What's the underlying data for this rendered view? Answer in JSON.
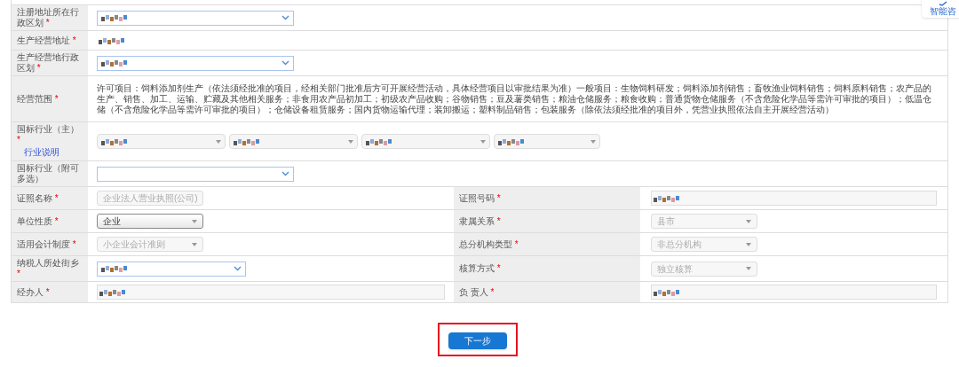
{
  "rows": [
    {
      "cells": [
        {
          "label": "注册地址所在行政区划",
          "required_mark": "*",
          "field": {
            "kind": "dropdown",
            "redacted": true
          }
        }
      ]
    },
    {
      "cells": [
        {
          "label": "生产经营地址",
          "required_mark": "*",
          "field": {
            "kind": "plain",
            "redacted": true
          }
        }
      ]
    },
    {
      "cells": [
        {
          "label": "生产经营地行政区划",
          "required_mark": "*",
          "field": {
            "kind": "dropdown",
            "redacted": true
          }
        }
      ]
    },
    {
      "cells": [
        {
          "label": "经营范围",
          "required_mark": "*",
          "field": {
            "kind": "paragraph",
            "text": "许可项目：饲料添加剂生产（依法须经批准的项目，经相关部门批准后方可开展经营活动，具体经营项目以审批结果为准）一般项目：生物饲料研发；饲料添加剂销售；畜牧渔业饲料销售；饲料原料销售；农产品的生产、销售、加工、运输、贮藏及其他相关服务；非食用农产品初加工；初级农产品收购；谷物销售；豆及薯类销售；粮油仓储服务；粮食收购；普通货物仓储服务（不含危险化学品等需许可审批的项目）；低温仓储（不含危险化学品等需许可审批的项目）；仓储设备租赁服务；国内货物运输代理；装卸搬运；塑料制品销售；包装服务（除依法须经批准的项目外，凭营业执照依法自主开展经营活动）"
          }
        }
      ]
    },
    {
      "cells": [
        {
          "label": "国标行业（主）",
          "required_mark": "*",
          "link": "行业说明",
          "field": {
            "kind": "multi",
            "selects": [
              {
                "redacted": true
              },
              {
                "redacted": true
              },
              {
                "redacted": true
              },
              {
                "redacted": true
              }
            ]
          }
        }
      ]
    },
    {
      "cells": [
        {
          "label": "国标行业（附可多选）",
          "field": {
            "kind": "dropdown",
            "redacted": false
          }
        }
      ]
    },
    {
      "cells": [
        {
          "label": "证照名称",
          "required_mark": "*",
          "field": {
            "kind": "select",
            "value": "企业法人营业执照(公司)",
            "disabled": true
          }
        },
        {
          "label": "证照号码",
          "required_mark": "*",
          "field": {
            "kind": "input",
            "redacted": true
          }
        }
      ]
    },
    {
      "cells": [
        {
          "label": "单位性质",
          "required_mark": "*",
          "field": {
            "kind": "select",
            "value": "企业",
            "disabled": false
          }
        },
        {
          "label": "隶属关系",
          "required_mark": "*",
          "field": {
            "kind": "select",
            "value": "县市",
            "disabled": true
          }
        }
      ]
    },
    {
      "cells": [
        {
          "label": "适用会计制度",
          "required_mark": "*",
          "field": {
            "kind": "select",
            "value": "小企业会计准则",
            "disabled": true
          }
        },
        {
          "label": "总分机构类型",
          "required_mark": "*",
          "field": {
            "kind": "select",
            "value": "非总分机构",
            "disabled": true
          }
        }
      ]
    },
    {
      "cells": [
        {
          "label": "纳税人所处街乡",
          "required_mark": "*",
          "field": {
            "kind": "dropdown-small",
            "redacted": true
          }
        },
        {
          "label": "核算方式",
          "required_mark": "*",
          "field": {
            "kind": "select",
            "value": "独立核算",
            "disabled": true
          }
        }
      ]
    },
    {
      "cells": [
        {
          "label": "经办人",
          "required_mark": "*",
          "field": {
            "kind": "input",
            "redacted": true
          }
        },
        {
          "label": "负 责人",
          "required_mark": "*",
          "field": {
            "kind": "input",
            "redacted": true
          }
        }
      ]
    }
  ],
  "next_button": "下一步",
  "assistant": {
    "label": "智能咨"
  }
}
